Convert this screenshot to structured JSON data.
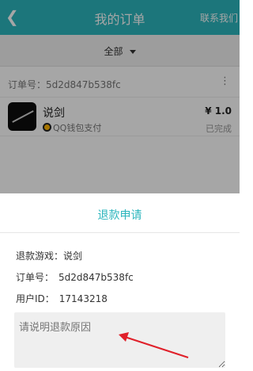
{
  "header": {
    "title": "我的订单",
    "contact": "联系我们"
  },
  "filter": {
    "label": "全部"
  },
  "order": {
    "number_text": "订单号：5d2d847b538fc",
    "game_name": "说剑",
    "payment": "QQ钱包支付",
    "price": "¥ 1.0",
    "status": "已完成"
  },
  "refund": {
    "title": "退款申请",
    "game_label": "退款游戏：",
    "game_value": "说剑",
    "order_label": "订单号：",
    "order_value": "5d2d847b538fc",
    "user_label": "用户ID：",
    "user_value": "17143218",
    "reason_placeholder": "请说明退款原因"
  },
  "colors": {
    "accent": "#2bb5bd",
    "arrow": "#e0202a"
  }
}
